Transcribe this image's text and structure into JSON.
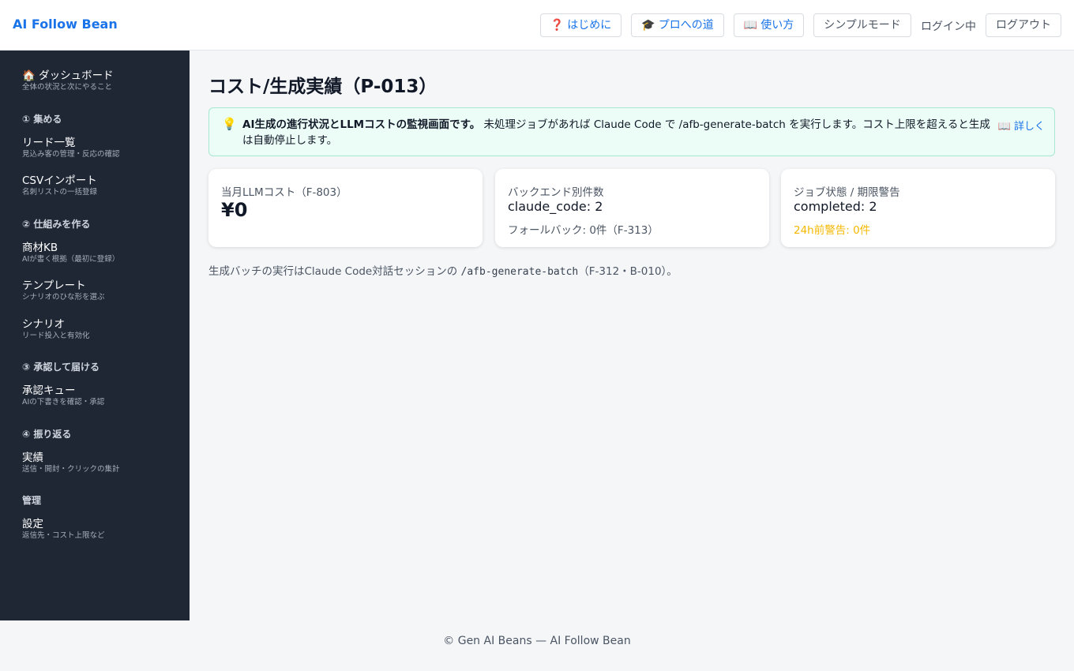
{
  "header": {
    "brand": "AI Follow Bean",
    "buttons": {
      "intro_icon": "❓",
      "intro": "はじめに",
      "pro_icon": "🎓",
      "pro": "プロへの道",
      "howto_icon": "📖",
      "howto": "使い方",
      "simple": "シンプルモード",
      "logout": "ログアウト"
    },
    "login_state": "ログイン中"
  },
  "sidebar": {
    "dashboard": {
      "icon": "🏠",
      "label": "ダッシュボード",
      "sub": "全体の状況と次にやること"
    },
    "sections": {
      "collect": "① 集める",
      "build": "② 仕組みを作る",
      "approve": "③ 承認して届ける",
      "review": "④ 振り返る",
      "admin": "管理"
    },
    "items": [
      {
        "label": "リード一覧",
        "sub": "見込み客の管理・反応の確認"
      },
      {
        "label": "CSVインポート",
        "sub": "名刺リストの一括登録"
      },
      {
        "label": "商材KB",
        "sub": "AIが書く根拠（最初に登録）"
      },
      {
        "label": "テンプレート",
        "sub": "シナリオのひな形を選ぶ"
      },
      {
        "label": "シナリオ",
        "sub": "リード投入と有効化"
      },
      {
        "label": "承認キュー",
        "sub": "AIの下書きを確認・承認"
      },
      {
        "label": "実績",
        "sub": "送信・開封・クリックの集計"
      },
      {
        "label": "設定",
        "sub": "返信先・コスト上限など"
      }
    ]
  },
  "main": {
    "title": "コスト/生成実績（P-013）",
    "notice": {
      "icon": "💡",
      "bold": "AI生成の進行状況とLLMコストの監視画面です。",
      "text": " 未処理ジョブがあれば Claude Code で /afb-generate-batch を実行します。コスト上限を超えると生成は自動停止します。",
      "link": "📖 詳しく"
    },
    "cards": {
      "cost": {
        "label": "当月LLMコスト（F-803）",
        "value": "¥0"
      },
      "backend": {
        "label": "バックエンド別件数",
        "value": "claude_code: 2",
        "sub": "フォールバック: 0件（F-313）"
      },
      "jobs": {
        "label": "ジョブ状態 / 期限警告",
        "value": "completed: 2",
        "warn": "24h前警告: 0件"
      }
    },
    "footnote": {
      "prefix": "生成バッチの実行はClaude Code対話セッションの ",
      "code": "/afb-generate-batch",
      "suffix": "（F-312・B-010）。"
    }
  },
  "footer": {
    "text": "© Gen AI Beans — AI Follow Bean"
  },
  "colors": {
    "accent": "#1a73e8",
    "sidebar": "#1f2735",
    "warn": "#f5b800",
    "notice_bg": "#ecfdf7"
  }
}
